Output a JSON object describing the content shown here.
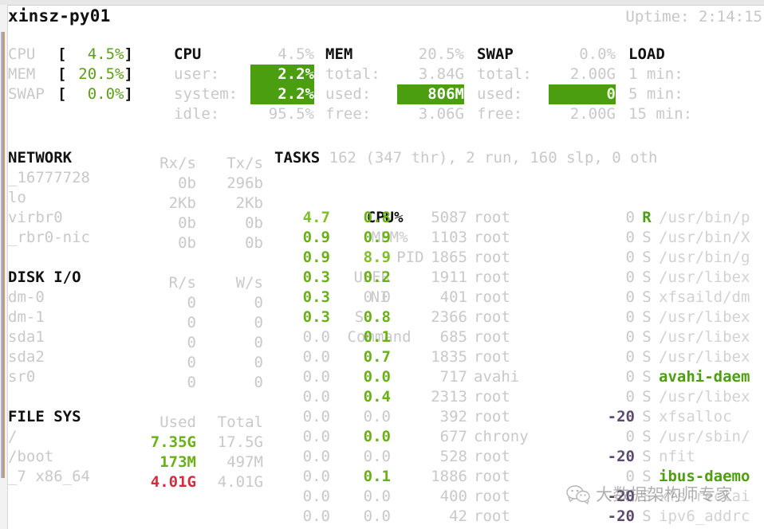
{
  "header": {
    "hostname": "xinsz-py01",
    "uptime_label": "Uptime:",
    "uptime_value": "2:14:15"
  },
  "quicklook": {
    "rows": [
      {
        "label": "CPU",
        "open": "[",
        "value": "4.5%",
        "close": "]"
      },
      {
        "label": "MEM",
        "open": "[",
        "value": "20.5%",
        "close": "]"
      },
      {
        "label": "SWAP",
        "open": "[",
        "value": "0.0%",
        "close": "]"
      }
    ]
  },
  "cpu": {
    "title": "CPU",
    "total": "4.5%",
    "rows": [
      {
        "key": "user:",
        "value": "2.2%",
        "highlight": true
      },
      {
        "key": "system:",
        "value": "2.2%",
        "highlight": true
      },
      {
        "key": "idle:",
        "value": "95.5%",
        "highlight": false
      }
    ]
  },
  "mem": {
    "title": "MEM",
    "percent": "20.5%",
    "rows": [
      {
        "key": "total:",
        "value": "3.84G",
        "highlight": false
      },
      {
        "key": "used:",
        "value": "806M",
        "highlight": true
      },
      {
        "key": "free:",
        "value": "3.06G",
        "highlight": false
      }
    ]
  },
  "swap": {
    "title": "SWAP",
    "percent": "0.0%",
    "rows": [
      {
        "key": "total:",
        "value": "2.00G",
        "highlight": false
      },
      {
        "key": "used:",
        "value": "0",
        "highlight": true
      },
      {
        "key": "free:",
        "value": "2.00G",
        "highlight": false
      }
    ]
  },
  "load": {
    "title": "LOAD",
    "rows": [
      {
        "key": "1 min:",
        "value": ""
      },
      {
        "key": "5 min:",
        "value": ""
      },
      {
        "key": "15 min:",
        "value": ""
      }
    ]
  },
  "network": {
    "title": "NETWORK",
    "columns": [
      "Rx/s",
      "Tx/s"
    ],
    "rows": [
      {
        "name": "_16777728",
        "rx": "0b",
        "tx": "296b"
      },
      {
        "name": "lo",
        "rx": "2Kb",
        "tx": "2Kb"
      },
      {
        "name": "virbr0",
        "rx": "0b",
        "tx": "0b"
      },
      {
        "name": "_rbr0-nic",
        "rx": "0b",
        "tx": "0b"
      }
    ]
  },
  "diskio": {
    "title": "DISK I/O",
    "columns": [
      "R/s",
      "W/s"
    ],
    "rows": [
      {
        "name": "dm-0",
        "r": "0",
        "w": "0"
      },
      {
        "name": "dm-1",
        "r": "0",
        "w": "0"
      },
      {
        "name": "sda1",
        "r": "0",
        "w": "0"
      },
      {
        "name": "sda2",
        "r": "0",
        "w": "0"
      },
      {
        "name": "sr0",
        "r": "0",
        "w": "0"
      }
    ]
  },
  "filesys": {
    "title": "FILE SYS",
    "columns": [
      "Used",
      "Total"
    ],
    "rows": [
      {
        "name": "/",
        "used": "7.35G",
        "total": "17.5G",
        "level": "ok"
      },
      {
        "name": "/boot",
        "used": "173M",
        "total": "497M",
        "level": "ok"
      },
      {
        "name": "_7 x86_64",
        "used": "4.01G",
        "total": "4.01G",
        "level": "critical"
      }
    ]
  },
  "tasks": {
    "title": "TASKS",
    "summary": "162 (347 thr), 2 run, 160 slp, 0 oth",
    "columns": {
      "cpu": "CPU%",
      "mem": "MEM%",
      "pid": "PID",
      "user": "USER",
      "ni": "NI",
      "s": "S",
      "command": "Command"
    },
    "rows": [
      {
        "cpu": "4.7",
        "cpu_level": "careful",
        "mem": "0.8",
        "mem_level": "ok",
        "pid": "5087",
        "user": "root",
        "ni": "0",
        "ni_neg": false,
        "s": "R",
        "command": "/usr/bin/p",
        "cmd_tail": "p"
      },
      {
        "cpu": "0.9",
        "cpu_level": "ok",
        "mem": "0.9",
        "mem_level": "ok",
        "pid": "1103",
        "user": "root",
        "ni": "0",
        "ni_neg": false,
        "s": "S",
        "command": "/usr/bin/X",
        "cmd_tail": "X"
      },
      {
        "cpu": "0.9",
        "cpu_level": "ok",
        "mem": "8.9",
        "mem_level": "careful",
        "pid": "1865",
        "user": "root",
        "ni": "0",
        "ni_neg": false,
        "s": "S",
        "command": "/usr/bin/g",
        "cmd_tail": "g"
      },
      {
        "cpu": "0.3",
        "cpu_level": "ok",
        "mem": "0.2",
        "mem_level": "ok",
        "pid": "1911",
        "user": "root",
        "ni": "0",
        "ni_neg": false,
        "s": "S",
        "command": "/usr/libex",
        "cmd_tail": ""
      },
      {
        "cpu": "0.3",
        "cpu_level": "ok",
        "mem": "0.0",
        "mem_level": "dim",
        "pid": "401",
        "user": "root",
        "ni": "0",
        "ni_neg": false,
        "s": "S",
        "command": "xfsaild/dm",
        "cmd_tail": ""
      },
      {
        "cpu": "0.3",
        "cpu_level": "ok",
        "mem": "0.8",
        "mem_level": "ok",
        "pid": "2366",
        "user": "root",
        "ni": "0",
        "ni_neg": false,
        "s": "S",
        "command": "/usr/libex",
        "cmd_tail": ""
      },
      {
        "cpu": "0.0",
        "cpu_level": "dim",
        "mem": "0.1",
        "mem_level": "ok",
        "pid": "685",
        "user": "root",
        "ni": "0",
        "ni_neg": false,
        "s": "S",
        "command": "/usr/libex",
        "cmd_tail": ""
      },
      {
        "cpu": "0.0",
        "cpu_level": "dim",
        "mem": "0.7",
        "mem_level": "ok",
        "pid": "1835",
        "user": "root",
        "ni": "0",
        "ni_neg": false,
        "s": "S",
        "command": "/usr/libex",
        "cmd_tail": ""
      },
      {
        "cpu": "0.0",
        "cpu_level": "dim",
        "mem": "0.0",
        "mem_level": "ok",
        "pid": "717",
        "user": "avahi",
        "ni": "0",
        "ni_neg": false,
        "s": "S",
        "command": "avahi-daem",
        "cmd_hl": true
      },
      {
        "cpu": "0.0",
        "cpu_level": "dim",
        "mem": "0.4",
        "mem_level": "ok",
        "pid": "2313",
        "user": "root",
        "ni": "0",
        "ni_neg": false,
        "s": "S",
        "command": "/usr/libex",
        "cmd_tail": ""
      },
      {
        "cpu": "0.0",
        "cpu_level": "dim",
        "mem": "0.0",
        "mem_level": "dim",
        "pid": "392",
        "user": "root",
        "ni": "-20",
        "ni_neg": true,
        "s": "S",
        "command": "xfsalloc",
        "cmd_tail": ""
      },
      {
        "cpu": "0.0",
        "cpu_level": "dim",
        "mem": "0.0",
        "mem_level": "ok",
        "pid": "677",
        "user": "chrony",
        "ni": "0",
        "ni_neg": false,
        "s": "S",
        "command": "/usr/sbin/",
        "cmd_tail": ""
      },
      {
        "cpu": "0.0",
        "cpu_level": "dim",
        "mem": "0.0",
        "mem_level": "dim",
        "pid": "528",
        "user": "root",
        "ni": "-20",
        "ni_neg": true,
        "s": "S",
        "command": "nfit",
        "cmd_tail": ""
      },
      {
        "cpu": "0.0",
        "cpu_level": "dim",
        "mem": "0.1",
        "mem_level": "ok",
        "pid": "1886",
        "user": "root",
        "ni": "0",
        "ni_neg": false,
        "s": "S",
        "command": "ibus-daemo",
        "cmd_hl": true
      },
      {
        "cpu": "0.0",
        "cpu_level": "dim",
        "mem": "0.0",
        "mem_level": "dim",
        "pid": "400",
        "user": "root",
        "ni": "-20",
        "ni_neg": true,
        "s": "S",
        "command": "xfs-reclai",
        "cmd_tail": ""
      },
      {
        "cpu": "0.0",
        "cpu_level": "dim",
        "mem": "0.0",
        "mem_level": "dim",
        "pid": "42",
        "user": "root",
        "ni": "-20",
        "ni_neg": true,
        "s": "S",
        "command": "ipv6_addrc",
        "cmd_tail": ""
      }
    ]
  },
  "watermark": {
    "text": "大数据架构师专家"
  },
  "colors": {
    "highlight_bg": "#4a9e10",
    "ok": "#5c9e1a",
    "careful": "#7fbf2a",
    "critical": "#d42c3e",
    "dim": "#c9c9c9",
    "bold": "#111111"
  }
}
